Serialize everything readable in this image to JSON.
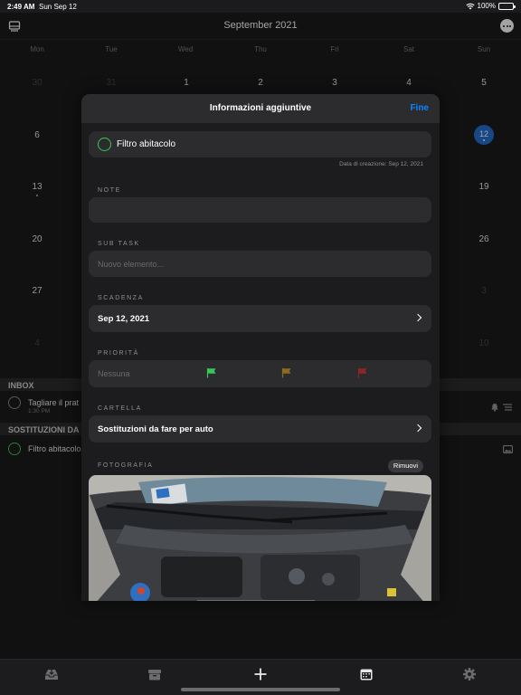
{
  "status_bar": {
    "time": "2:49 AM",
    "date": "Sun Sep 12",
    "battery": "100%",
    "battery_level": 1.0
  },
  "nav": {
    "title": "September 2021",
    "left_icon": "sidebar-icon",
    "right_icon": "ellipsis-circle-icon"
  },
  "calendar": {
    "weekdays": [
      "Mon",
      "Tue",
      "Wed",
      "Thu",
      "Fri",
      "Sat",
      "Sun"
    ],
    "days": {
      "w1_mon": "30",
      "w1_tue": "31",
      "w1_wed": "1",
      "w1_thu": "2",
      "w1_fri": "3",
      "w1_sat": "4",
      "w1_sun": "5",
      "w2_mon": "6",
      "w2_sun": "12",
      "w3_mon": "13",
      "w3_sun": "19",
      "w4_mon": "20",
      "w4_sun": "26",
      "w5_mon": "27",
      "w5_sun": "3",
      "w6_mon": "4",
      "w6_sun": "10"
    },
    "selected_day": "12"
  },
  "lists": {
    "inbox": {
      "header": "INBOX",
      "task_title": "Tagliare il prat",
      "task_time": "1:30 PM"
    },
    "replacements": {
      "header": "SOSTITUZIONI DA",
      "task_title": "Filtro abitacolo"
    }
  },
  "modal": {
    "title": "Informazioni aggiuntive",
    "done_label": "Fine",
    "task_name": "Filtro abitacolo",
    "created": "Data di creazione: Sep 12, 2021",
    "note_label": "NOTE",
    "note_value": "",
    "subtask_label": "SUB TASK",
    "subtask_placeholder": "Nuovo elemento...",
    "due_label": "SCADENZA",
    "due_value": "Sep 12, 2021",
    "priority_label": "PRIORITÀ",
    "priority_none": "Nessuna",
    "priority_colors": [
      "#35c759",
      "#8c6d1f",
      "#8f2525"
    ],
    "folder_label": "CARTELLA",
    "folder_value": "Sostituzioni da fare per auto",
    "photo_label": "FOTOGRAFIA",
    "remove_label": "Rimuovi"
  },
  "tab_bar": {
    "items": [
      "tray-icon",
      "archive-box-icon",
      "plus-icon",
      "calendar-icon",
      "gear-icon"
    ]
  }
}
